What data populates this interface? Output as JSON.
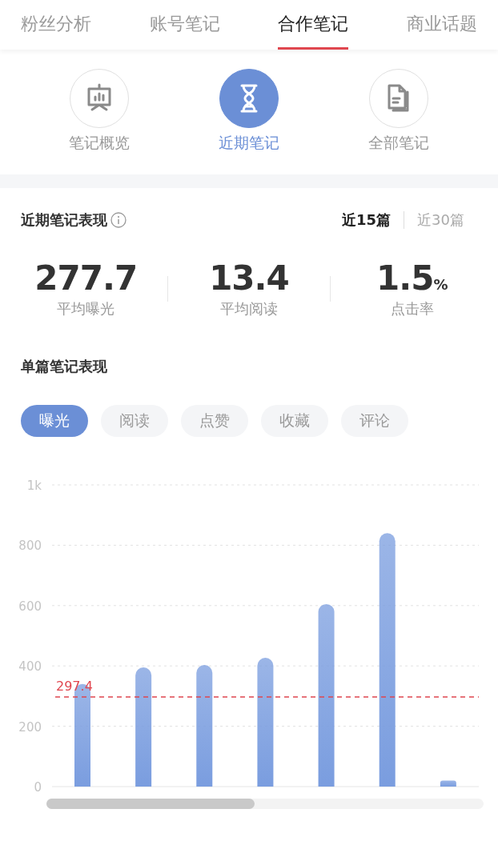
{
  "tabs": [
    {
      "label": "粉丝分析",
      "selected": false
    },
    {
      "label": "账号笔记",
      "selected": false
    },
    {
      "label": "合作笔记",
      "selected": true
    },
    {
      "label": "商业话题",
      "selected": false
    }
  ],
  "sub_nav": [
    {
      "label": "笔记概览",
      "kind": "presentation",
      "selected": false
    },
    {
      "label": "近期笔记",
      "kind": "hourglass",
      "selected": true
    },
    {
      "label": "全部笔记",
      "kind": "documents",
      "selected": false
    }
  ],
  "recent_performance": {
    "title": "近期笔记表现",
    "ranges": [
      {
        "label": "近15篇",
        "selected": true
      },
      {
        "label": "近30篇",
        "selected": false
      }
    ],
    "stats": [
      {
        "value": "277.7",
        "label": "平均曝光"
      },
      {
        "value": "13.4",
        "label": "平均阅读"
      },
      {
        "value": "1.5",
        "unit": "%",
        "label": "点击率"
      }
    ]
  },
  "single_performance": {
    "title": "单篇笔记表现",
    "metrics": [
      {
        "label": "曝光",
        "selected": true
      },
      {
        "label": "阅读",
        "selected": false
      },
      {
        "label": "点赞",
        "selected": false
      },
      {
        "label": "收藏",
        "selected": false
      },
      {
        "label": "评论",
        "selected": false
      }
    ],
    "chart_data": {
      "type": "bar",
      "grid": true,
      "series": [
        {
          "color": "#7a9ddf",
          "values": [
            340,
            395,
            403,
            427,
            605,
            840,
            20
          ]
        }
      ],
      "ylim": [
        0,
        1000
      ],
      "yticks": [
        0,
        200,
        400,
        600,
        800,
        {
          "value": 1000,
          "label": "1k"
        }
      ],
      "ref_lines": [
        {
          "axis": "y",
          "value": 297.4,
          "label": "297.4",
          "color": "#e0464f"
        }
      ]
    }
  }
}
